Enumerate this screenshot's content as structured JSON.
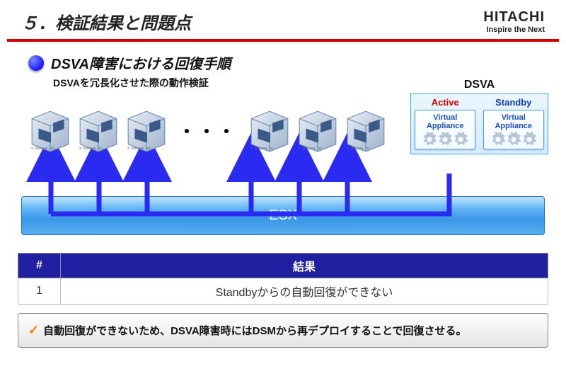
{
  "header": {
    "title": "５．検証結果と問題点",
    "logo_main": "HITACHI",
    "logo_sub": "Inspire the Next"
  },
  "section": {
    "title": "DSVA障害における回復手順",
    "subtitle": "DSVAを冗長化させた際の動作検証"
  },
  "diagram": {
    "vm_copyright": "© VMware, Inc.",
    "ellipsis": "・・・",
    "dsva_label": "DSVA",
    "active_label": "Active",
    "standby_label": "Standby",
    "va_text1": "Virtual",
    "va_text2": "Appliance",
    "esx_label": "ESX"
  },
  "table": {
    "head_col1": "#",
    "head_col2": "結果",
    "row1_num": "1",
    "row1_result": "Standbyからの自動回復ができない"
  },
  "conclusion": {
    "check": "✓",
    "text": "自動回復ができないため、DSVA障害時にはDSMから再デプロイすることで回復させる。"
  }
}
